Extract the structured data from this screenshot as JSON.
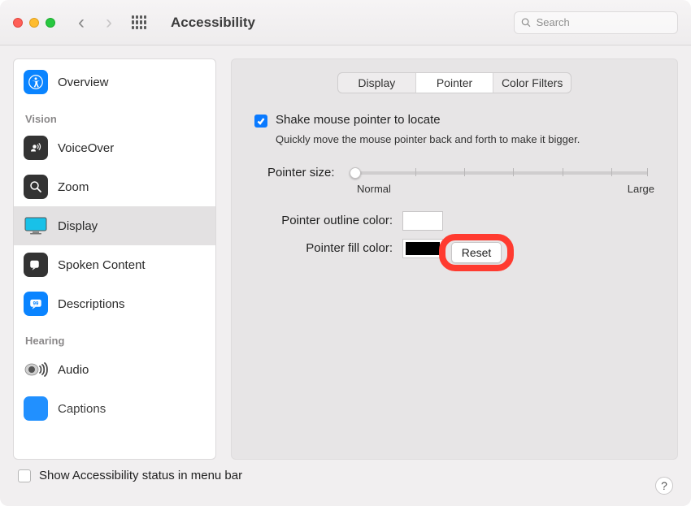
{
  "window": {
    "title": "Accessibility",
    "search_placeholder": "Search"
  },
  "sidebar": {
    "overview": "Overview",
    "section_vision": "Vision",
    "voiceover": "VoiceOver",
    "zoom": "Zoom",
    "display": "Display",
    "spoken_content": "Spoken Content",
    "descriptions": "Descriptions",
    "section_hearing": "Hearing",
    "audio": "Audio",
    "captions": "Captions"
  },
  "tabs": {
    "display": "Display",
    "pointer": "Pointer",
    "color_filters": "Color Filters",
    "selected": "pointer"
  },
  "pointer": {
    "shake_label": "Shake mouse pointer to locate",
    "shake_checked": true,
    "shake_desc": "Quickly move the mouse pointer back and forth to make it bigger.",
    "size_label": "Pointer size:",
    "size_min_label": "Normal",
    "size_max_label": "Large",
    "outline_label": "Pointer outline color:",
    "outline_color": "#ffffff",
    "fill_label": "Pointer fill color:",
    "fill_color": "#000000",
    "reset_label": "Reset"
  },
  "footer": {
    "status_label": "Show Accessibility status in menu bar",
    "status_checked": false,
    "help": "?"
  }
}
